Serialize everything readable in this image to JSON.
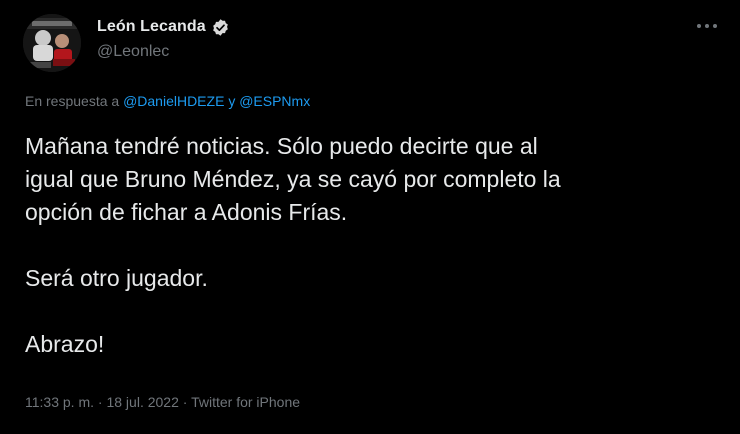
{
  "author": {
    "display_name": "León Lecanda",
    "handle": "@Leonlec",
    "verified": true,
    "avatar_icon": "profile-photo"
  },
  "reply": {
    "prefix": "En respuesta a",
    "mention_1": "@DanielHDEZE",
    "joiner": "y",
    "mention_2": "@ESPNmx"
  },
  "tweet": {
    "line_1": "Mañana tendré noticias. Sólo puedo decirte que al",
    "line_2": "igual que Bruno Méndez, ya se cayó por completo la",
    "line_3": "opción de fichar a Adonis Frías.",
    "paragraph_2": "Será otro jugador.",
    "paragraph_3": "Abrazo!"
  },
  "meta": {
    "time": "11:33 p. m.",
    "date": "18 jul. 2022",
    "source": "Twitter for iPhone",
    "separator": "·"
  },
  "colors": {
    "background": "#000000",
    "text": "#e7e9ea",
    "secondary": "#71767b",
    "link": "#1d9bf0",
    "verified_badge": "#d9d9d9"
  },
  "icons": {
    "verified": "verified-badge-icon",
    "more": "more-options-icon"
  }
}
